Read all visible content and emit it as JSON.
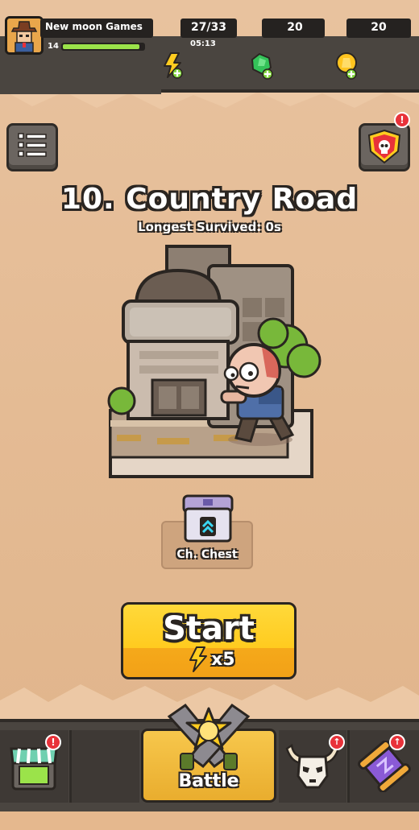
{
  "player": {
    "name": "New moon Games",
    "level": "14",
    "xp_fraction": 0.95
  },
  "resources": {
    "energy": "27/33",
    "energy_timer": "05:13",
    "gems": "20",
    "coins": "20"
  },
  "stage": {
    "title": "10. Country Road",
    "subtitle": "Longest Survived: 0s"
  },
  "chest": {
    "label": "Ch. Chest"
  },
  "start": {
    "label": "Start",
    "cost": "x5"
  },
  "nav": {
    "battle_label": "Battle"
  },
  "badges": {
    "alert": "!",
    "upgrade": "↑"
  },
  "colors": {
    "background": "#e4bb94",
    "bar": "#4a4540",
    "start_button": "#ffcb1f",
    "xp": "#9be34a",
    "badge": "#e8323a"
  }
}
